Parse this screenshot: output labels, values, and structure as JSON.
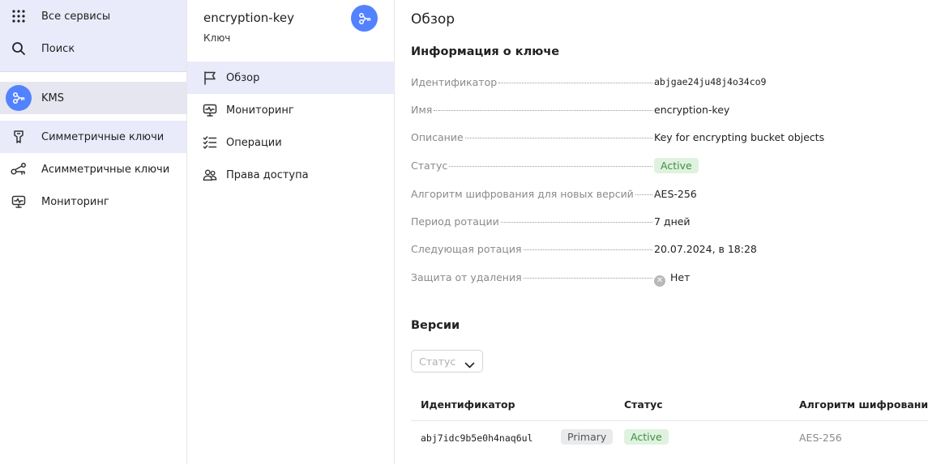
{
  "global_nav": {
    "all_services": "Все сервисы",
    "search": "Поиск",
    "service": "KMS",
    "items": [
      {
        "label": "Симметричные ключи",
        "icon": "key-icon"
      },
      {
        "label": "Асимметричные ключи",
        "icon": "asymmetric-key-icon"
      },
      {
        "label": "Мониторинг",
        "icon": "monitor-icon"
      }
    ]
  },
  "resource_nav": {
    "title": "encryption-key",
    "subtitle": "Ключ",
    "items": [
      {
        "label": "Обзор",
        "icon": "flag-icon"
      },
      {
        "label": "Мониторинг",
        "icon": "monitor-icon"
      },
      {
        "label": "Операции",
        "icon": "operations-list-icon"
      },
      {
        "label": "Права доступа",
        "icon": "users-icon"
      }
    ]
  },
  "main": {
    "title": "Обзор",
    "info_title": "Информация о ключе",
    "props": [
      {
        "key": "Идентификатор",
        "value": "abjgae24ju48j4o34co9"
      },
      {
        "key": "Имя",
        "value": "encryption-key"
      },
      {
        "key": "Описание",
        "value": "Key for encrypting bucket objects"
      },
      {
        "key": "Статус",
        "value": "Active"
      },
      {
        "key": "Алгоритм шифрования для новых версий",
        "value": "AES-256"
      },
      {
        "key": "Период ротации",
        "value": "7 дней"
      },
      {
        "key": "Следующая ротация",
        "value": "20.07.2024, в 18:28"
      },
      {
        "key": "Защита от удаления",
        "value": "Нет"
      }
    ],
    "versions_title": "Версии",
    "status_filter_placeholder": "Статус",
    "table": {
      "headers": [
        "Идентификатор",
        "Статус",
        "Алгоритм шифрования"
      ],
      "rows": [
        {
          "id": "abj7idc9b5e0h4naq6ul",
          "tag": "Primary",
          "status": "Active",
          "algorithm": "AES-256"
        }
      ]
    }
  },
  "colors": {
    "accent": "#5282ff",
    "active_bg": "#e9ebfa",
    "status_green_bg": "#dff2df",
    "status_green_text": "#3e8e41"
  }
}
